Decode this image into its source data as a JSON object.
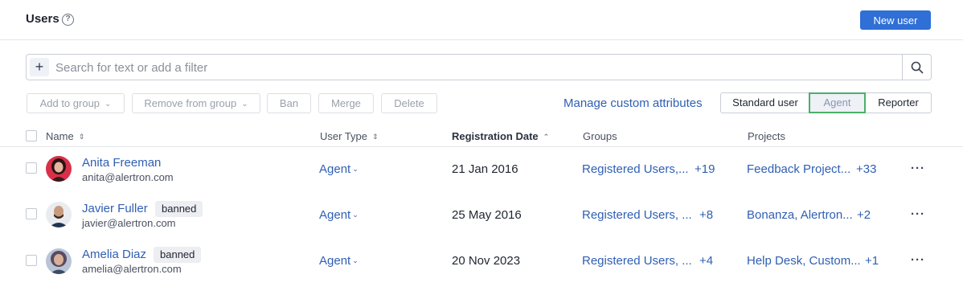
{
  "header": {
    "title": "Users",
    "help_icon": "?",
    "new_user_label": "New user"
  },
  "search": {
    "add_icon": "+",
    "placeholder": "Search for text or add a filter",
    "value": ""
  },
  "toolbar": {
    "add_to_group": "Add to group",
    "remove_from_group": "Remove from group",
    "ban": "Ban",
    "merge": "Merge",
    "delete": "Delete",
    "manage_custom_attributes": "Manage custom attributes",
    "segments": [
      "Standard user",
      "Agent",
      "Reporter"
    ],
    "selected_segment": "Agent"
  },
  "table": {
    "columns": {
      "name": "Name",
      "user_type": "User Type",
      "registration_date": "Registration Date",
      "groups": "Groups",
      "projects": "Projects"
    },
    "rows": [
      {
        "name": "Anita Freeman",
        "email": "anita@alertron.com",
        "badge": "",
        "user_type": "Agent",
        "registration_date": "21 Jan 2016",
        "groups": "Registered Users,...",
        "groups_more": "+19",
        "projects": "Feedback Project...",
        "projects_more": "+33",
        "more": "···"
      },
      {
        "name": "Javier Fuller",
        "email": "javier@alertron.com",
        "badge": "banned",
        "user_type": "Agent",
        "registration_date": "25 May 2016",
        "groups": "Registered Users, ...",
        "groups_more": "+8",
        "projects": "Bonanza, Alertron...",
        "projects_more": "+2",
        "more": "···"
      },
      {
        "name": "Amelia Diaz",
        "email": "amelia@alertron.com",
        "badge": "banned",
        "user_type": "Agent",
        "registration_date": "20 Nov 2023",
        "groups": "Registered Users, ...",
        "groups_more": "+4",
        "projects": "Help Desk, Custom...",
        "projects_more": "+1",
        "more": "···"
      }
    ]
  },
  "colors": {
    "accent": "#2f6fd6",
    "link": "#2f5fb3",
    "selected_segment_border": "#4caf6a"
  }
}
